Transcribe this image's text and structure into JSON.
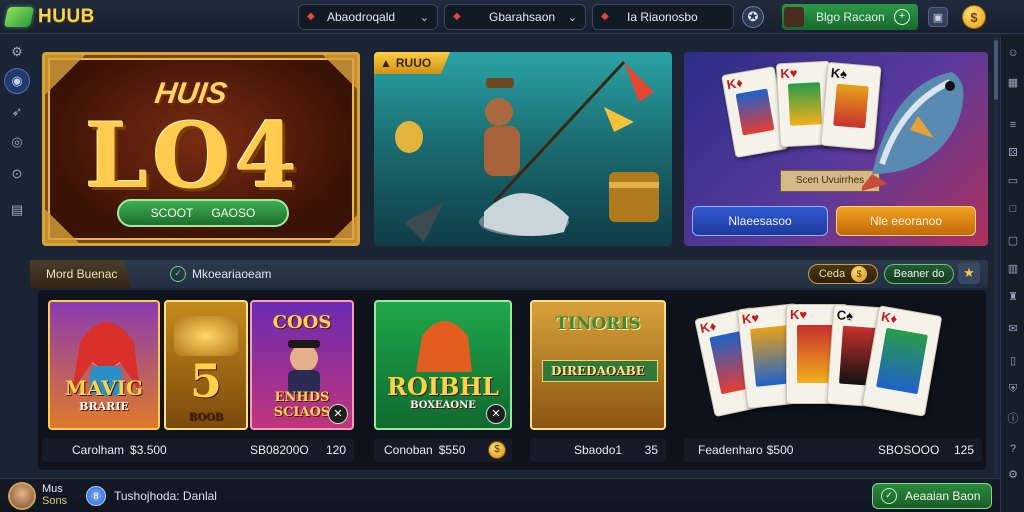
{
  "header": {
    "logo_text": "HUUB",
    "selectors": [
      {
        "label": "Abaodroqald"
      },
      {
        "label": "Gbarahsaon"
      },
      {
        "label": "Ia Riaonosbo"
      }
    ],
    "deposit_label": "Blgo Racaon",
    "deposit_plus": "+",
    "coin_symbol": "$"
  },
  "left_rail": {
    "icons": [
      "settings-icon",
      "home-icon",
      "rocket-icon",
      "globe-icon",
      "support-icon",
      "document-icon"
    ]
  },
  "banners": [
    {
      "sub_title": "HUIS",
      "big_title": "LO4",
      "pill_left": "SCOOT",
      "pill_right": "GAOSO"
    },
    {
      "tag_label": "RUUO"
    },
    {
      "card_sign": "Scen Uvuirrhes",
      "button_left": "Nlaeesasoo",
      "button_right": "Nle eeoranoo"
    }
  ],
  "section": {
    "title": "Mord Buenac",
    "filter_label": "Mkoeariaoeam",
    "pill_left": "Ceda",
    "pill_right": "Beaner do",
    "pill_left_icon": "$"
  },
  "games": [
    {
      "title": "MAVIG",
      "subtitle": "BRARIE"
    },
    {
      "title": "5",
      "subtitle": "BOOB"
    },
    {
      "title": "COOS",
      "subtitle": "ENHDS SCIAOS"
    },
    {
      "title": "ROIBHL",
      "subtitle": "BOXEAONE"
    },
    {
      "title": "TINORIS",
      "subtitle": "DIREDAOABE"
    },
    {
      "title": "",
      "subtitle": ""
    }
  ],
  "captions": [
    {
      "left": "Carolham",
      "mid": "$3.500",
      "right": "SB08200O",
      "right_val": "120"
    },
    {
      "left": "Conoban",
      "mid": "$550",
      "icon": "$"
    },
    {
      "left": "Sbaodo1",
      "right_val": "35"
    },
    {
      "left": "Feadenharo",
      "mid": "$500",
      "right": "SBOSOOO",
      "right_val": "125"
    }
  ],
  "footer": {
    "user_line1": "Mus",
    "user_line2": "Sons",
    "badge": "8",
    "message": "Tushojhoda: Danlal",
    "action_label": "Aeaaian Baon"
  },
  "colors": {
    "accent_gold": "#ffcc4d",
    "accent_green": "#2a9a45",
    "background": "#1b2433"
  }
}
